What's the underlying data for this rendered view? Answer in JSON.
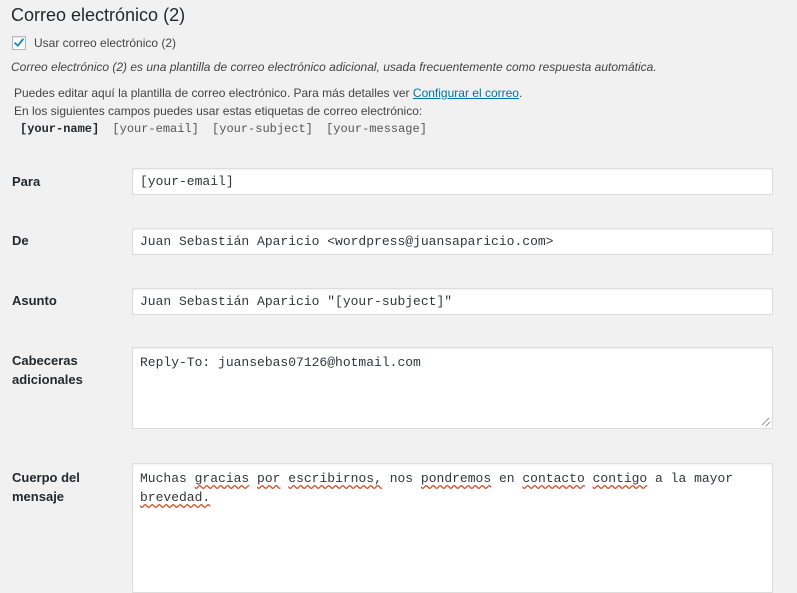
{
  "section": {
    "title": "Correo electrónico (2)",
    "toggle_label": "Usar correo electrónico (2)",
    "toggle_checked": true,
    "description": "Correo electrónico (2) es una plantilla de correo electrónico adicional, usada frecuentemente como respuesta automática.",
    "edit_note_prefix": "Puedes editar aquí la plantilla de correo electrónico. Para más detalles ver",
    "edit_note_link": "Configurar el correo",
    "edit_note_suffix": ".",
    "tags_intro": "En los siguientes campos puedes usar estas etiquetas de correo electrónico:",
    "tags": [
      "[your-name]",
      "[your-email]",
      "[your-subject]",
      "[your-message]"
    ]
  },
  "fields": {
    "para": {
      "label": "Para",
      "value": "[your-email]"
    },
    "de": {
      "label": "De",
      "value": "Juan Sebastián Aparicio <wordpress@juansaparicio.com>"
    },
    "asunto": {
      "label": "Asunto",
      "value": "Juan Sebastián Aparicio \"[your-subject]\""
    },
    "cabeceras": {
      "label_line1": "Cabeceras",
      "label_line2": "adicionales",
      "value": "Reply-To: juansebas07126@hotmail.com"
    },
    "cuerpo": {
      "label_line1": "Cuerpo del",
      "label_line2": "mensaje",
      "words": [
        "Muchas",
        "gracias",
        "por",
        "escribirnos,",
        "nos",
        "pondremos",
        "en",
        "contacto",
        "contigo",
        "a",
        "la",
        "mayor"
      ],
      "line2": "brevedad."
    }
  },
  "colors": {
    "link": "#0073aa",
    "checkmark": "#1e8cbe",
    "spellcheck": "#d54e21"
  }
}
